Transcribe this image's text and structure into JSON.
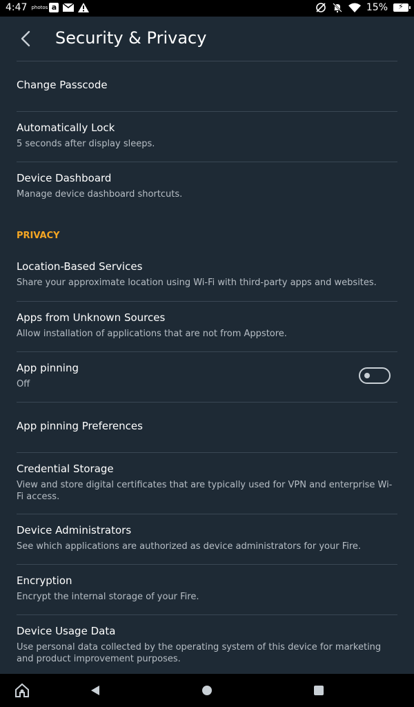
{
  "status": {
    "time": "4:47",
    "photos": "photos",
    "amazon": "a",
    "battery": "15%"
  },
  "header": {
    "title": "Security & Privacy"
  },
  "items_top": [
    {
      "title": "Change Passcode",
      "subtitle": ""
    },
    {
      "title": "Automatically Lock",
      "subtitle": "5 seconds after display sleeps."
    },
    {
      "title": "Device Dashboard",
      "subtitle": "Manage device dashboard shortcuts."
    }
  ],
  "privacy_label": "PRIVACY",
  "items_privacy": [
    {
      "title": "Location-Based Services",
      "subtitle": "Share your approximate location using Wi-Fi with third-party apps and websites."
    },
    {
      "title": "Apps from Unknown Sources",
      "subtitle": "Allow installation of applications that are not from Appstore."
    },
    {
      "title": "App pinning",
      "subtitle": "Off"
    },
    {
      "title": "App pinning Preferences",
      "subtitle": ""
    },
    {
      "title": "Credential Storage",
      "subtitle": "View and store digital certificates that are typically used for VPN and enterprise Wi-Fi access."
    },
    {
      "title": "Device Administrators",
      "subtitle": "See which applications are authorized as device administrators for your Fire."
    },
    {
      "title": "Encryption",
      "subtitle": "Encrypt the internal storage of your Fire."
    },
    {
      "title": "Device Usage Data",
      "subtitle": "Use personal data collected by the operating system of this device for marketing and product improvement purposes."
    }
  ],
  "app_pinning_toggle": {
    "state": "off"
  },
  "colors": {
    "background": "#1e2a35",
    "accent": "#f5a623",
    "divider": "#3a4754"
  }
}
